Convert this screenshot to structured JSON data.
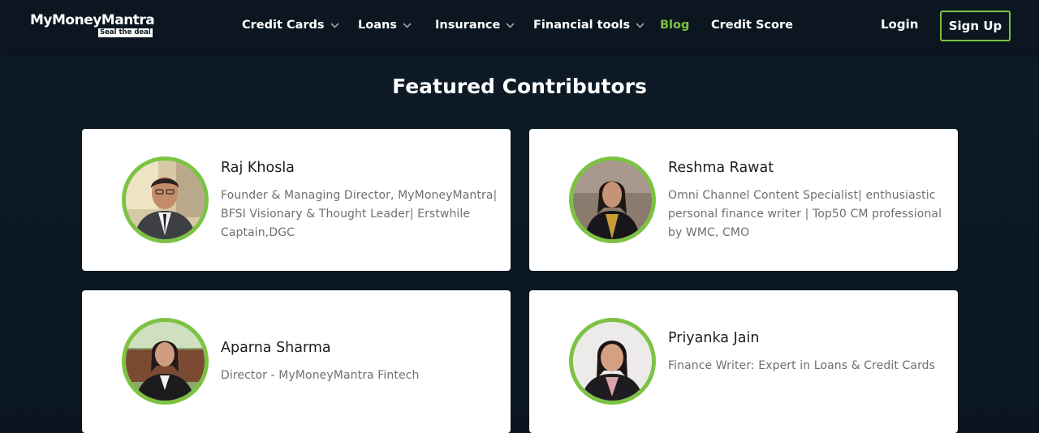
{
  "brand": {
    "name": "MyMoneyMantra",
    "tagline": "Seal the deal",
    "accent": "#7cc243",
    "background": "#0b1620"
  },
  "nav": {
    "items": [
      {
        "label": "Credit Cards",
        "has_dropdown": true
      },
      {
        "label": "Loans",
        "has_dropdown": true
      },
      {
        "label": "Insurance",
        "has_dropdown": true
      },
      {
        "label": "Financial tools",
        "has_dropdown": true
      },
      {
        "label": "Blog",
        "has_dropdown": false,
        "active": true
      },
      {
        "label": "Credit Score",
        "has_dropdown": false
      }
    ],
    "login_label": "Login",
    "signup_label": "Sign Up"
  },
  "section": {
    "title": "Featured Contributors"
  },
  "contributors": [
    {
      "name": "Raj Khosla",
      "description": "Founder & Managing Director, MyMoneyMantra| BFSI Visionary & Thought Leader| Erstwhile Captain,DGC",
      "avatar_icon": "contributor-photo"
    },
    {
      "name": "Reshma Rawat",
      "description": "Omni Channel Content Specialist| enthusiastic personal finance writer | Top50 CM professional by WMC, CMO",
      "avatar_icon": "contributor-photo"
    },
    {
      "name": "Aparna Sharma",
      "description": "Director - MyMoneyMantra Fintech",
      "avatar_icon": "contributor-photo"
    },
    {
      "name": "Priyanka Jain",
      "description": "Finance Writer: Expert in Loans & Credit Cards",
      "avatar_icon": "contributor-photo"
    }
  ]
}
